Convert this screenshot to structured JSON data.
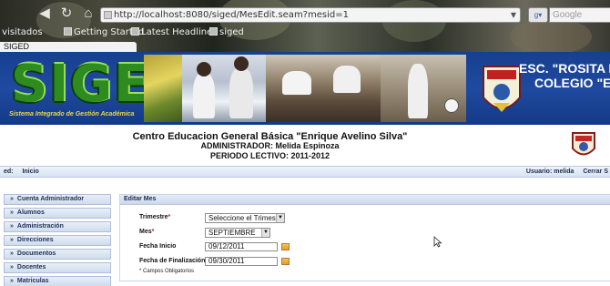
{
  "browser": {
    "url": "http://localhost:8080/siged/MesEdit.seam?mesid=1",
    "search_placeholder": "Google",
    "bookmarks": [
      "Más visitados",
      "Getting Started",
      "Latest Headlines",
      "siged"
    ],
    "tab_title": "SIGED"
  },
  "banner": {
    "logo_text": "SIGED",
    "logo_subtitle": "Sistema Integrado de Gestión Académica",
    "school_line1": "ESC. \"ROSITA PARE",
    "school_line2": "COLEGIO \"EL CHA"
  },
  "header": {
    "title": "Centro Educacion General Básica \"Enrique Avelino Silva\"",
    "admin": "ADMINISTRADOR: Melida Espinoza",
    "period": "PERIODO LECTIVO: 2011-2012"
  },
  "statusbar": {
    "left_prefix": "ed:",
    "left_link": "Inicio",
    "user": "Usuario: melida",
    "logout": "Cerrar S"
  },
  "sidebar": {
    "items": [
      {
        "label": "Cuenta Administrador"
      },
      {
        "label": "Alumnos"
      },
      {
        "label": "Administración"
      },
      {
        "label": "Direcciones"
      },
      {
        "label": "Documentos"
      },
      {
        "label": "Docentes"
      },
      {
        "label": "Matriculas"
      }
    ]
  },
  "form": {
    "title": "Editar Mes",
    "trimestre_label": "Trimestre",
    "trimestre_value": "Seleccione el Trimestre",
    "mes_label": "Mes",
    "mes_value": "SEPTIEMBRE",
    "fecha_inicio_label": "Fecha Inicio",
    "fecha_inicio_value": "09/12/2011",
    "fecha_fin_label": "Fecha de Finalización",
    "fecha_fin_value": "09/30/2011",
    "required_mark": "*",
    "required_note": "* Campos Obligatorios"
  },
  "colors": {
    "banner_blue": "#1f4aa0",
    "required_red": "#cc1f1f",
    "panel_header": "#cbd8ec"
  }
}
